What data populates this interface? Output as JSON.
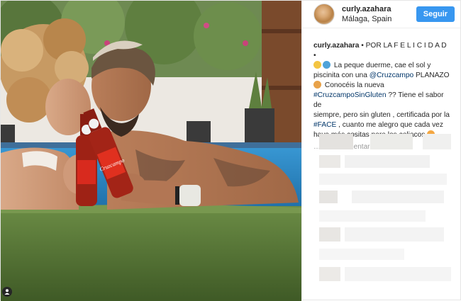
{
  "header": {
    "username": "curly.azahara",
    "location": "Málaga, Spain",
    "follow_label": "Seguir"
  },
  "caption": {
    "username": "curly.azahara",
    "line1": "• POR LA F E L I C I D A D •",
    "line2": "La peque duerme, cae el sol y",
    "line3a": "piscinita con una ",
    "mention": "@Cruzcampo",
    "line3b": " PLANAZO",
    "line4": "Conocéis la nueva",
    "hashtag1": "#CruzcampoSinGluten",
    "line5": " ?? Tiene el sabor de",
    "line6": "siempre, pero sin gluten , certificada por la",
    "hashtag2": "#FACE",
    "line7": " , cuanto me alegro que cada vez",
    "line8": "haya más cositas para los celiacos"
  },
  "comments": {
    "load_label": "…r más comentarios"
  },
  "photo": {
    "bottle_label": "Cruzcampo"
  },
  "colors": {
    "follow_bg": "#3897f0",
    "link": "#003569",
    "grass": "#5b7a3a",
    "pool": "#2f8fd0"
  },
  "icons": {
    "tag": "person-tag-icon"
  }
}
